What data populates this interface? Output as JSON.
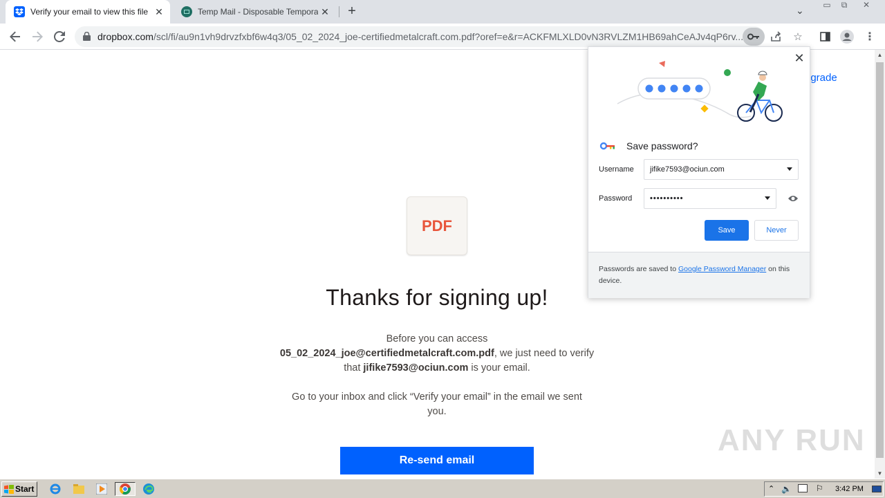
{
  "browser": {
    "tabs": [
      {
        "title": "Verify your email to view this file",
        "active": true,
        "favicon": "dropbox-icon"
      },
      {
        "title": "Temp Mail - Disposable Temporary Em",
        "active": false,
        "favicon": "tempmail-icon"
      }
    ],
    "url_host": "dropbox.com",
    "url_path": "/scl/fi/au9n1vh9drvzfxbf6w4q3/05_02_2024_joe-certifiedmetalcraft.com.pdf?oref=e&r=ACKFMLXLD0vN3RVLZM1HB69ahCeAJv4qP6rv..."
  },
  "page": {
    "file_badge": "PDF",
    "heading": "Thanks for signing up!",
    "para1_prefix": "Before you can access",
    "para1_file": "05_02_2024_joe@certifiedmetalcraft.com.pdf",
    "para1_mid": ", we just need to verify that",
    "para1_email": "jifike7593@ociun.com",
    "para1_suffix": "is your email.",
    "para2": "Go to your inbox and click “Verify your email” in the email we sent you.",
    "resend_button": "Re-send email",
    "upgrade_link": "pgrade"
  },
  "save_password": {
    "title": "Save password?",
    "username_label": "Username",
    "username_value": "jifike7593@ociun.com",
    "password_label": "Password",
    "password_value": "••••••••••",
    "save_button": "Save",
    "never_button": "Never",
    "footer_prefix": "Passwords are saved to",
    "footer_link": "Google Password Manager",
    "footer_suffix": "on this device."
  },
  "watermark": "ANY RUN",
  "taskbar": {
    "start_label": "Start",
    "clock": "3:42 PM"
  },
  "colors": {
    "dropbox_blue": "#0061fe",
    "chrome_blue": "#1a73e8",
    "pdf_red": "#e8553b"
  }
}
